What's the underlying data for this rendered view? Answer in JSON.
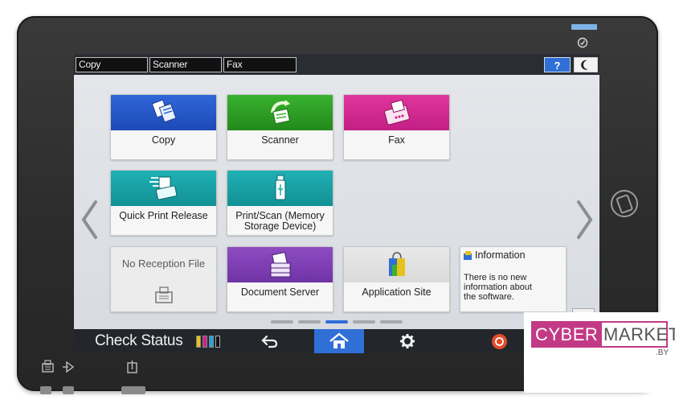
{
  "top_tabs": [
    "Copy",
    "Scanner",
    "Fax"
  ],
  "help_label": "?",
  "tiles": {
    "copy": "Copy",
    "scanner": "Scanner",
    "fax": "Fax",
    "quick_print_release": "Quick Print Release",
    "print_scan_line1": "Print/Scan (Memory",
    "print_scan_line2": "Storage Device)",
    "no_reception_file": "No Reception File",
    "document_server": "Document Server",
    "application_site": "Application Site"
  },
  "information": {
    "title": "Information",
    "body_line1": "There is no new",
    "body_line2": "information about",
    "body_line3": "the software."
  },
  "bottom_bar": {
    "check_status": "Check Status"
  },
  "page_indicator": {
    "count": 5,
    "active_index": 2
  },
  "toner_colors": [
    "#e8c21c",
    "#d21f8a",
    "#1fa6e0",
    "#111111"
  ],
  "colors": {
    "copy": "#2f67d8",
    "scanner": "#39b22f",
    "fax": "#e0359c",
    "quick_print_release": "#1fb1b4",
    "print_scan": "#1fb1b4",
    "document_server": "#8e4cc2",
    "home_active": "#2f6fd6"
  },
  "watermark": {
    "word1": "CYBER",
    "word2": "MARKET",
    "suffix": ".BY"
  }
}
